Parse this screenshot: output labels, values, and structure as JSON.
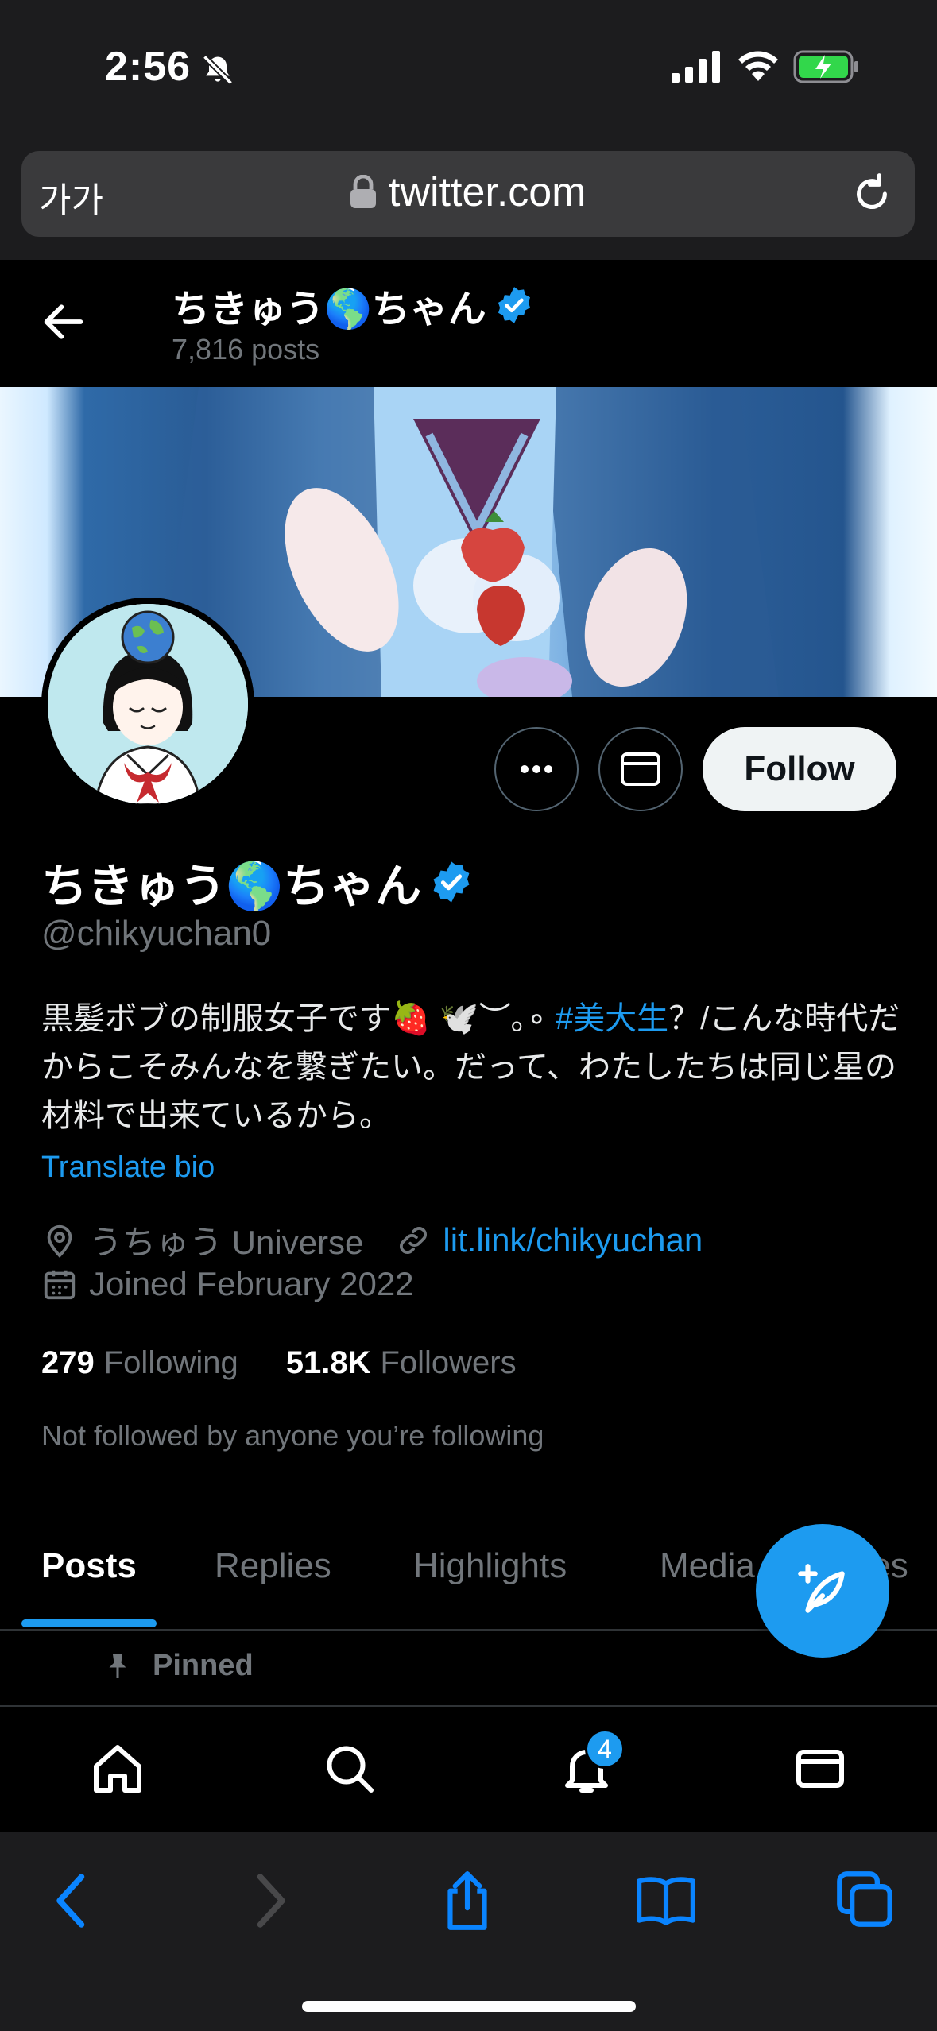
{
  "status_bar": {
    "time": "2:56"
  },
  "browser": {
    "reader_label": "가가",
    "url": "twitter.com"
  },
  "header": {
    "name": "ちきゅう🌎ちゃん",
    "posts_count": "7,816 posts"
  },
  "profile": {
    "name": "ちきゅう🌎ちゃん",
    "handle": "@chikyuchan0",
    "bio_part1": "黒髪ボブの制服女子です🍓 🕊️︶｡∘ ",
    "bio_hashtag": "#美大生",
    "bio_part2": "？/こんな時代だからこそみんなを繋ぎたい。だって、わたしたちは同じ星の材料で出来ているから。",
    "translate_label": "Translate bio",
    "location": "うちゅう Universe",
    "website": "lit.link/chikyuchan",
    "joined": "Joined February 2022",
    "following_count": "279",
    "following_label": "Following",
    "followers_count": "51.8K",
    "followers_label": "Followers",
    "not_followed_text": "Not followed by anyone you’re following"
  },
  "actions": {
    "follow_label": "Follow"
  },
  "tabs": [
    {
      "label": "Posts"
    },
    {
      "label": "Replies"
    },
    {
      "label": "Highlights"
    },
    {
      "label": "Media"
    },
    {
      "label": "Likes"
    }
  ],
  "pinned_label": "Pinned",
  "bottom_nav": {
    "notifications_badge": "4"
  },
  "colors": {
    "accent": "#1d9bf0",
    "background": "#000000",
    "follow_button": "#eff3f4"
  }
}
